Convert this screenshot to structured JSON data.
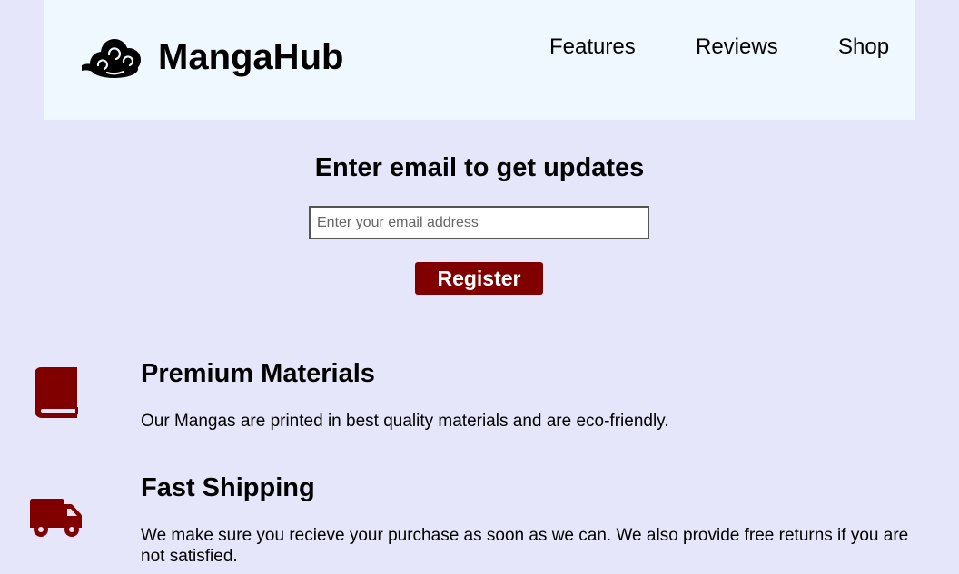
{
  "header": {
    "brand": "MangaHub",
    "logo_icon": "cloud-logo-icon",
    "nav": {
      "features": "Features",
      "reviews": "Reviews",
      "shop": "Shop"
    }
  },
  "signup": {
    "title": "Enter email to get updates",
    "email_placeholder": "Enter your email address",
    "email_value": "",
    "register_label": "Register"
  },
  "features": [
    {
      "icon": "book-icon",
      "title": "Premium Materials",
      "description": "Our Mangas are printed in best quality materials and are eco-friendly."
    },
    {
      "icon": "truck-icon",
      "title": "Fast Shipping",
      "description": "We make sure you recieve your purchase as soon as we can. We also provide free returns if you are not satisfied."
    }
  ],
  "colors": {
    "page_background": "#e6e6fa",
    "header_background": "#f0f8ff",
    "accent": "#800000"
  }
}
